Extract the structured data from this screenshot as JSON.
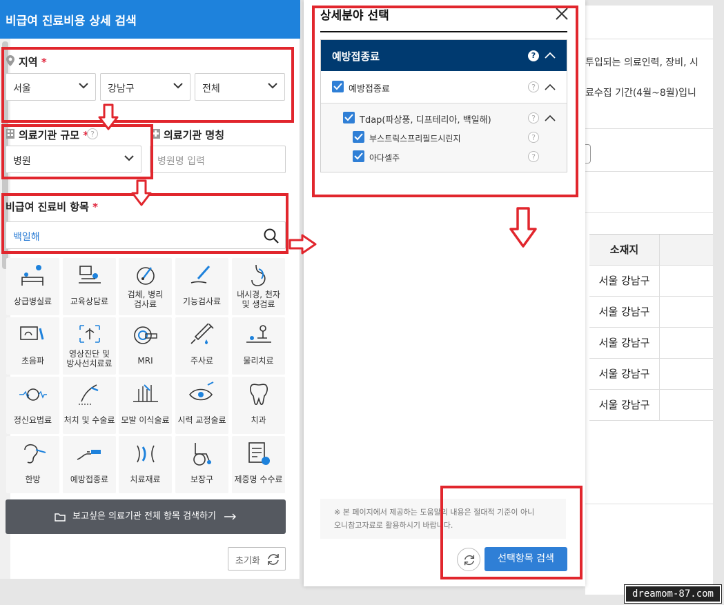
{
  "background_page": {
    "text_line_1": "투입되는 의료인력, 장비, 시",
    "text_line_2": "료수집 기간(4월~8월)입니",
    "table_header": "소재지",
    "rows": [
      "서울 강남구",
      "서울 강남구",
      "서울 강남구",
      "서울 강남구",
      "서울 강남구"
    ]
  },
  "left_panel": {
    "title": "비급여 진료비용 상세 검색",
    "region": {
      "label": "지역",
      "required_mark": "*",
      "city": "서울",
      "district": "강남구",
      "sub": "전체"
    },
    "scale": {
      "label": "의료기관 규모",
      "required_mark": "*",
      "value": "병원"
    },
    "name": {
      "label": "의료기관 명칭",
      "placeholder": "병원명 입력"
    },
    "item": {
      "label": "비급여 진료비 항목",
      "required_mark": "*",
      "value": "백일해"
    },
    "categories": [
      "상급병실료",
      "교육상담료",
      "검체, 병리\n검사료",
      "기능검사료",
      "내시경, 천자\n및 생검료",
      "초음파",
      "영상진단 및\n방사선치료료",
      "MRI",
      "주사료",
      "물리치료",
      "정신요법료",
      "처치 및 수술료",
      "모발 이식술료",
      "시력 교정술료",
      "치과",
      "한방",
      "예방접종료",
      "치료재료",
      "보장구",
      "제증명 수수료"
    ],
    "all_button": "보고싶은 의료기관 전체 항목 검색하기",
    "reset_button": "초기화"
  },
  "modal": {
    "title": "상세분야 선택",
    "category": "예방접종료",
    "tree": {
      "level1": "예방접종료",
      "level2": "Tdap(파상풍, 디프테리아, 백일해)",
      "level3": [
        "부스트릭스프리필드시린지",
        "아다셀주"
      ]
    },
    "notice_line1": "※ 본 페이지에서 제공하는 도움말의 내용은 절대적 기준이 아니",
    "notice_line2": "오니참고자료로 활용하시기 바랍니다.",
    "search_button": "선택항목 검색"
  },
  "watermark": "dreamom-87.com",
  "colors": {
    "header_blue": "#1e82dc",
    "navy": "#003a70",
    "accent_blue": "#2f7fd6",
    "annotation_red": "#e1262d",
    "required_red": "#e0243b"
  }
}
